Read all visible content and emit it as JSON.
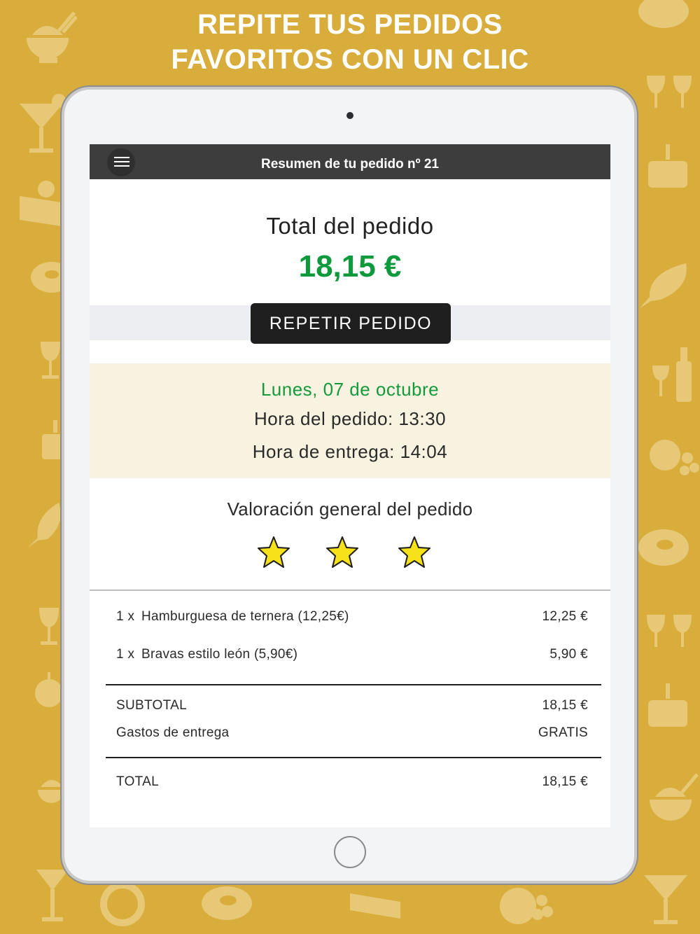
{
  "promo": {
    "line1": "REPITE TUS PEDIDOS",
    "line2": "FAVORITOS CON UN CLIC"
  },
  "header": {
    "title": "Resumen de tu pedido nº 21"
  },
  "summary": {
    "total_label": "Total del pedido",
    "total_amount": "18,15 €",
    "repeat_button": "REPETIR PEDIDO"
  },
  "schedule": {
    "date": "Lunes, 07 de octubre",
    "order_time": "Hora del pedido: 13:30",
    "delivery_time": "Hora de entrega: 14:04"
  },
  "rating": {
    "label": "Valoración general del pedido",
    "stars": 3
  },
  "items": [
    {
      "qty": "1 x",
      "name": "Hamburguesa de ternera (12,25€)",
      "price": "12,25 €"
    },
    {
      "qty": "1 x",
      "name": "Bravas estilo león (5,90€)",
      "price": "5,90 €"
    }
  ],
  "totals": {
    "subtotal_label": "SUBTOTAL",
    "subtotal_value": "18,15 €",
    "delivery_label": "Gastos de entrega",
    "delivery_value": "GRATIS",
    "total_label": "TOTAL",
    "total_value": "18,15 €"
  },
  "colors": {
    "background": "#d8ad3c",
    "accent_green": "#0e9a3c",
    "star_yellow": "#f7e11b",
    "appbar": "#3d3d3d"
  },
  "icons": [
    "noodle-bowl-icon",
    "cocktail-icon",
    "cake-slice-icon",
    "steak-icon",
    "wine-glass-icon",
    "birthday-cake-icon",
    "fish-icon",
    "wine-bottle-icon",
    "fruit-icon",
    "menu-icon",
    "star-icon"
  ]
}
